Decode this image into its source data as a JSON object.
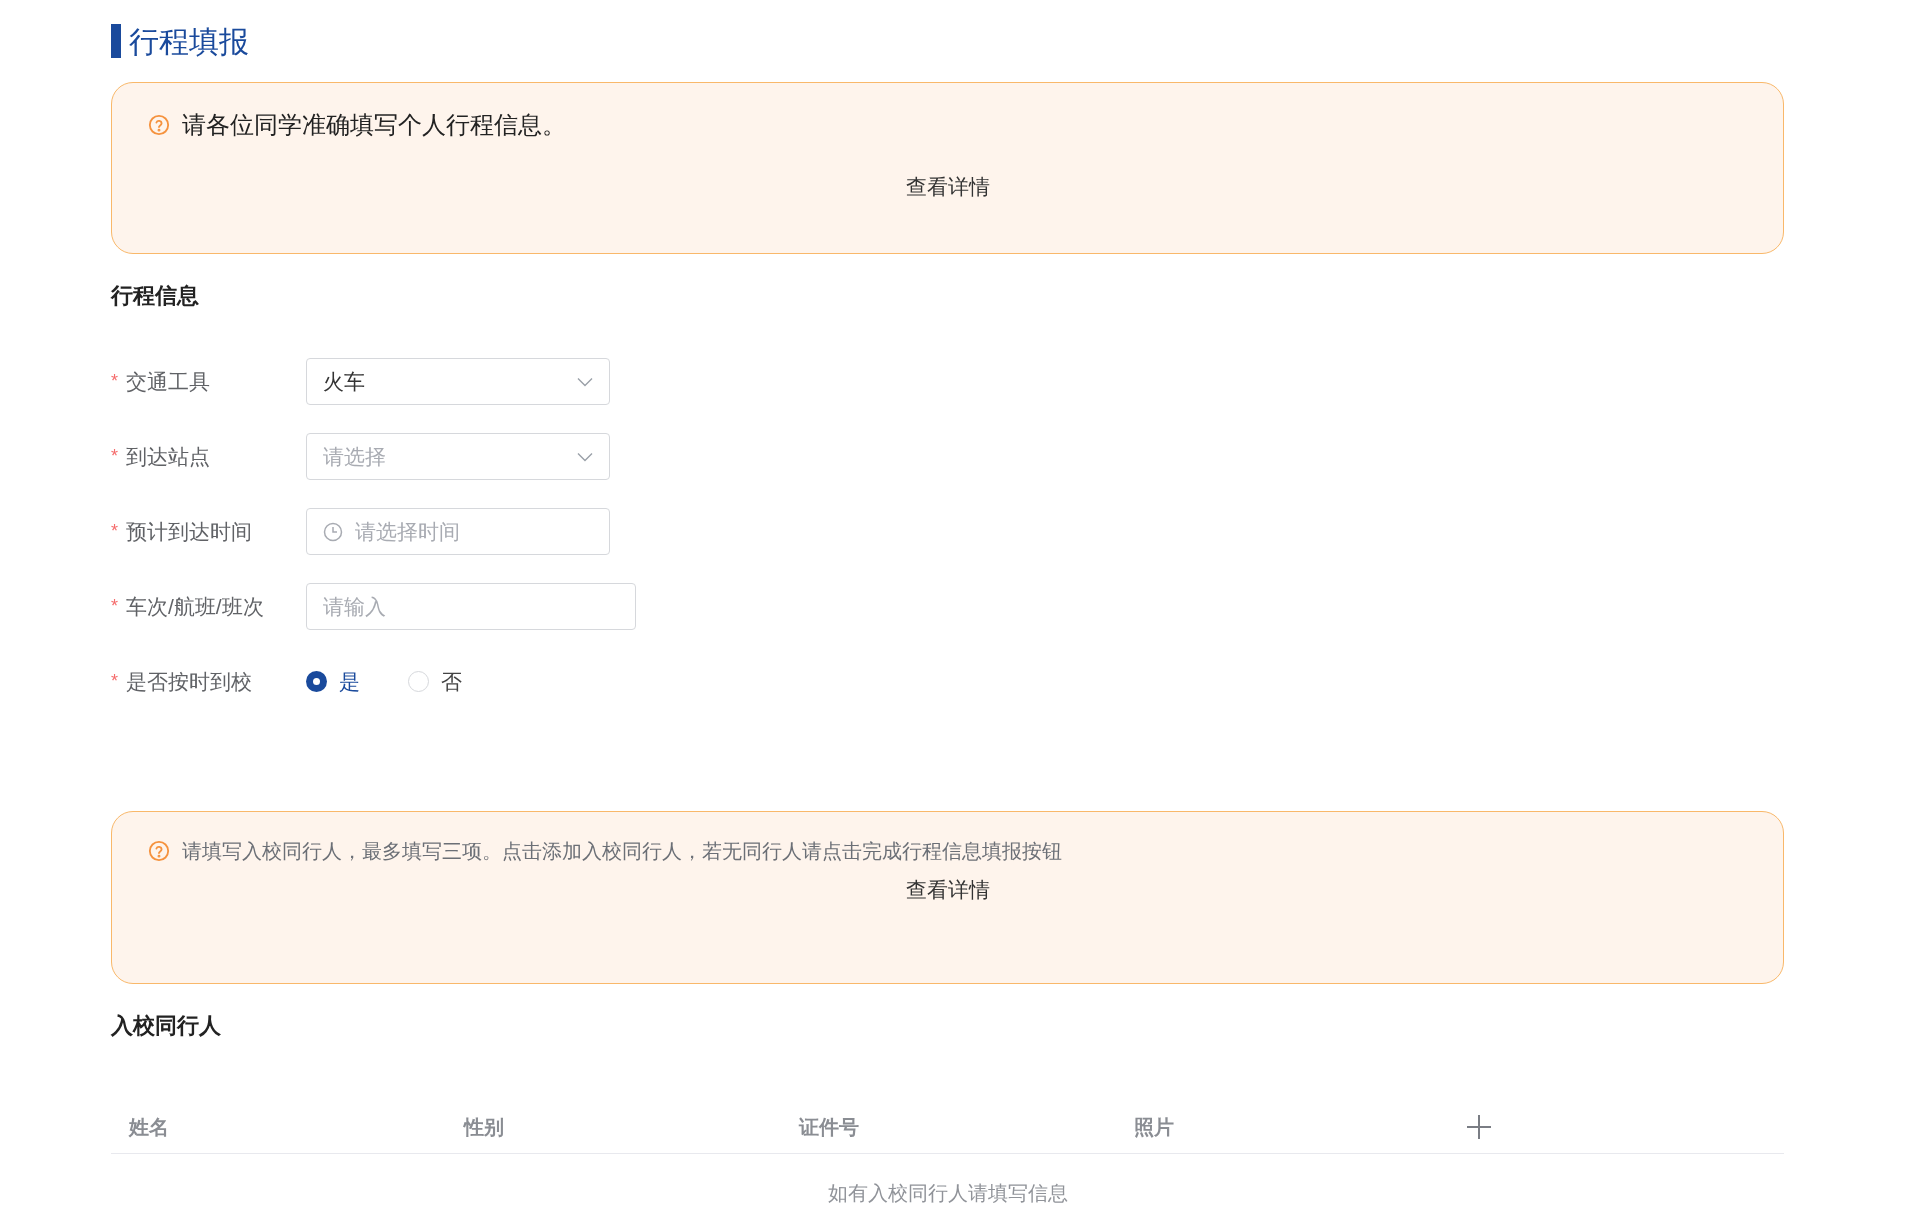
{
  "page_title": "行程填报",
  "notice_top": {
    "text": "请各位同学准确填写个人行程信息。",
    "link": "查看详情"
  },
  "trip_section": {
    "title": "行程信息",
    "fields": [
      {
        "kind": "select",
        "required_mark": "*",
        "label": "交通工具",
        "value": "火车"
      },
      {
        "kind": "select",
        "required_mark": "*",
        "label": "到达站点",
        "placeholder": "请选择"
      },
      {
        "kind": "time",
        "required_mark": "*",
        "label": "预计到达时间",
        "placeholder": "请选择时间"
      },
      {
        "kind": "text",
        "required_mark": "*",
        "label": "车次/航班/班次",
        "placeholder": "请输入"
      },
      {
        "kind": "radio",
        "required_mark": "*",
        "label": "是否按时到校",
        "options": [
          {
            "label": "是",
            "selected": true
          },
          {
            "label": "否",
            "selected": false
          }
        ]
      }
    ]
  },
  "notice_bottom": {
    "text": "请填写入校同行人，最多填写三项。点击添加入校同行人，若无同行人请点击完成行程信息填报按钮",
    "link": "查看详情"
  },
  "companions": {
    "title": "入校同行人",
    "columns": [
      "姓名",
      "性别",
      "证件号",
      "照片"
    ],
    "empty_text": "如有入校同行人请填写信息"
  }
}
